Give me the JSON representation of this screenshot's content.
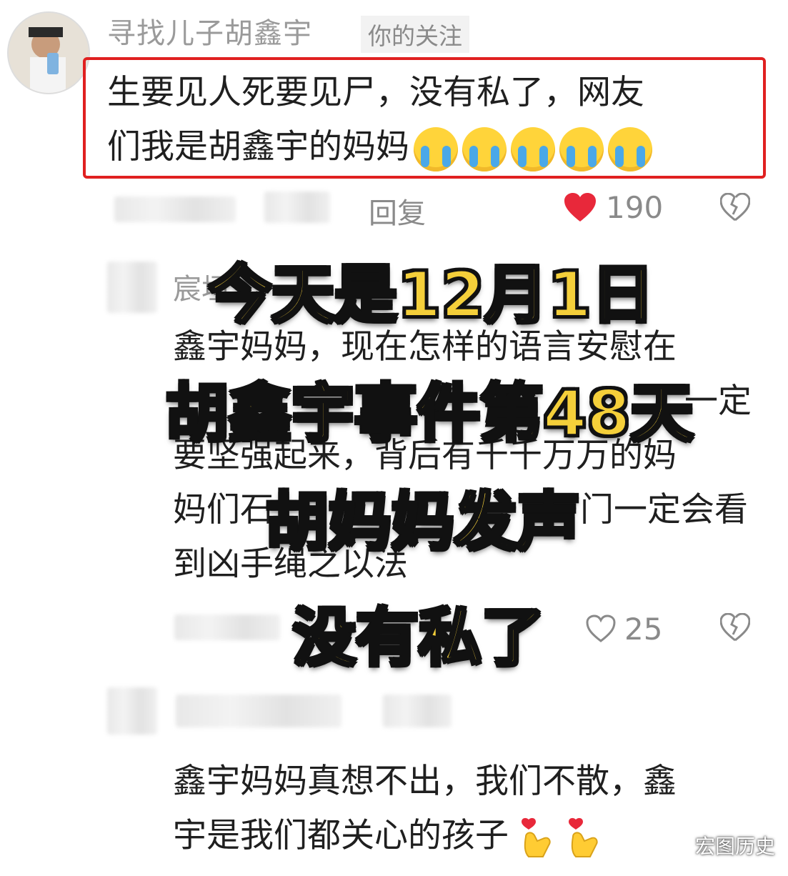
{
  "comment1": {
    "username": "寻找儿子胡鑫宇",
    "follow_tag": "你的关注",
    "line1": "生要见人死要见尸，没有私了，网友",
    "line2": "们我是胡鑫宇的妈妈",
    "reply_label": "回复",
    "like_count": "190"
  },
  "comment2": {
    "username_partial": "宸垣",
    "line1": "鑫宇妈妈，现在怎样的语言安慰在",
    "line2_end": "一定",
    "line3": "要坚强起来，背后有千千万万的妈",
    "line4_start": "妈们石",
    "line4_end": "门一定会看",
    "line5": "到凶手绳之以法",
    "reply_label": "回复",
    "like_count": "25"
  },
  "comment3": {
    "line1": "鑫宇妈妈真想不出，我们不散，鑫",
    "line2": "宇是我们都关心的孩子"
  },
  "overlay": {
    "line1": "今天是12月1日",
    "line2": "胡鑫宇事件第48天",
    "line3": "胡妈妈发声",
    "line4": "没有私了"
  },
  "watermark": "宏图历史",
  "colors": {
    "highlight_border": "#e02020",
    "like_red": "#e8283a",
    "overlay_yellow": "#f4cf3a"
  },
  "icons": [
    "avatar",
    "cry-emoji",
    "heart-filled-icon",
    "heart-outline-icon",
    "broken-heart-icon",
    "finger-heart-emoji"
  ]
}
